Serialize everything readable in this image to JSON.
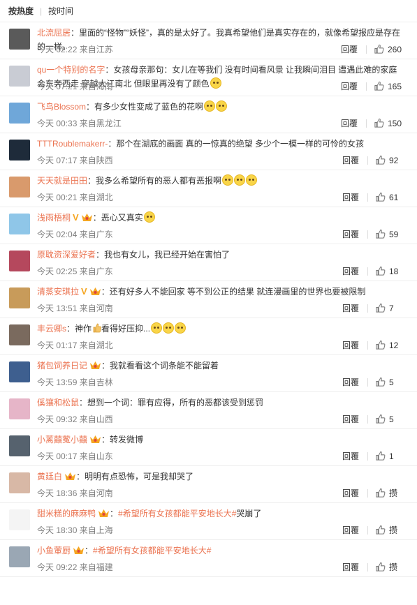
{
  "sort": {
    "hot": "按热度",
    "time": "按时间"
  },
  "actions": {
    "reply": "回覆"
  },
  "comments": [
    {
      "nick": "北流屈居",
      "text_parts": [
        "：里面的“怪物”“妖怪”，真的是太好了。我真希望他们是真实存在的，就像希望报应是存在的一样。"
      ],
      "emojis": 0,
      "meta": "今天 02:22 来自江苏",
      "likes": "260",
      "avatar_color": "#5a5a5a"
    },
    {
      "nick": "qu一个特别的名字",
      "text_parts": [
        "：女孩母亲那句：女儿在等我们 没有时间看风景 让我瞬间泪目 遭遇此难的家庭会东奔西走 穿越大江南北 但眼里再没有了颜色"
      ],
      "emojis": 1,
      "meta": "今天 07:21 来自海南",
      "likes": "165",
      "avatar_color": "#c9ccd4"
    },
    {
      "nick": "飞鸟Blossom",
      "text_parts": [
        "：有多少女性变成了蓝色的花啊"
      ],
      "emojis": 2,
      "meta": "今天 00:33 来自黑龙江",
      "likes": "150",
      "avatar_color": "#6fa7d9"
    },
    {
      "nick": "TTTRoublemakerr-",
      "text_parts": [
        "：那个在湖底的画面 真的一惊真的绝望 多少个一模一样的可怜的女孩"
      ],
      "emojis": 0,
      "meta": "今天 07:17 来自陕西",
      "likes": "92",
      "avatar_color": "#1e2b3a"
    },
    {
      "nick": "天天就是田田",
      "text_parts": [
        "：我多么希望所有的恶人都有恶报啊"
      ],
      "emojis": 3,
      "meta": "今天 00:21 来自湖北",
      "likes": "61",
      "avatar_color": "#d99a6c"
    },
    {
      "nick": "浅雨梧桐",
      "text_parts": [
        "：恶心又真实"
      ],
      "emojis": 1,
      "verified": "V",
      "crown": true,
      "meta": "今天 02:04 来自广东",
      "likes": "59",
      "avatar_color": "#8fc6e8"
    },
    {
      "nick": "原耽资深爱好者",
      "text_parts": [
        "：我也有女儿，我已经开始在害怕了"
      ],
      "emojis": 0,
      "meta": "今天 02:25 来自广东",
      "likes": "18",
      "avatar_color": "#b5485d"
    },
    {
      "nick": "清蒸安琪拉",
      "text_parts": [
        "：还有好多人不能回家 等不到公正的结果 就连漫画里的世界也要被限制"
      ],
      "emojis": 0,
      "verified": "V",
      "crown": true,
      "meta": "今天 13:51 来自河南",
      "likes": "7",
      "avatar_color": "#c89b5a"
    },
    {
      "nick": "丰云卿s",
      "text_parts": [
        "：神作",
        "看得好压抑..."
      ],
      "thumb": true,
      "emojis": 3,
      "meta": "今天 01:17 来自湖北",
      "likes": "12",
      "avatar_color": "#7a6a5e"
    },
    {
      "nick": "猪包饲养日记",
      "text_parts": [
        "：我就看看这个词条能不能留着"
      ],
      "emojis": 0,
      "crown": true,
      "meta": "今天 13:59 来自吉林",
      "likes": "5",
      "avatar_color": "#3e5f8f"
    },
    {
      "nick": "傒獽和松鼠",
      "text_parts": [
        "：想到一个词：罪有应得，所有的恶都该受到惩罚"
      ],
      "emojis": 0,
      "meta": "今天 09:32 来自山西",
      "likes": "5",
      "avatar_color": "#e6b5c8"
    },
    {
      "nick": "小蓠囍蒬小囍",
      "text_parts": [
        "：转发微博"
      ],
      "emojis": 0,
      "crown": true,
      "meta": "今天 00:17 来自山东",
      "likes": "1",
      "avatar_color": "#56626e"
    },
    {
      "nick": "黄廷白",
      "text_parts": [
        "：明明有点恐怖，可是我却哭了"
      ],
      "emojis": 0,
      "crown": true,
      "meta": "今天 18:36 来自河南",
      "likes": "攒",
      "avatar_color": "#d8b8a6"
    },
    {
      "nick": "甜米糕的麻麻鸭",
      "text_parts": [
        "：",
        "哭崩了"
      ],
      "hashtag": "#希望所有女孩都能平安地长大#",
      "emojis": 0,
      "crown": true,
      "meta": "今天 18:30 来自上海",
      "likes": "攒",
      "avatar_color": "#f4f4f4"
    },
    {
      "nick": "小鱼葷厨",
      "text_parts": [
        "："
      ],
      "hashtag": "#希望所有女孩都能平安地长大#",
      "emojis": 0,
      "crown": true,
      "meta": "今天 09:22 来自福建",
      "likes": "攒",
      "avatar_color": "#9aa7b4"
    }
  ]
}
